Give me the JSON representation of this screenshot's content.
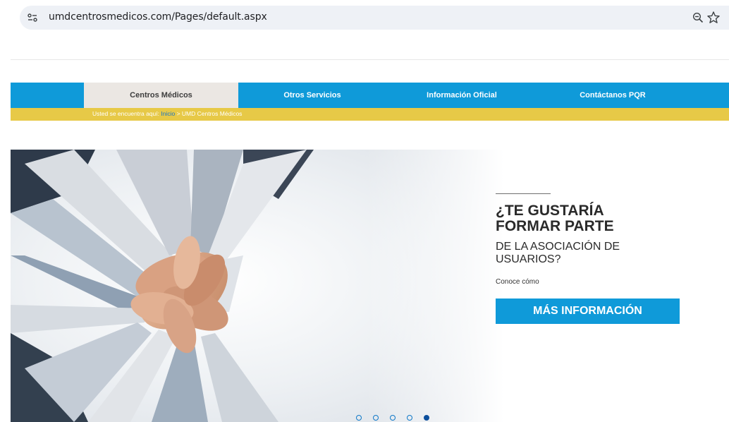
{
  "browser": {
    "url": "umdcentrosmedicos.com/Pages/default.aspx",
    "icons": [
      "site-info-icon",
      "zoom-icon",
      "bookmark-star-icon"
    ]
  },
  "nav": {
    "items": [
      {
        "label": "Centros Médicos",
        "active": true
      },
      {
        "label": "Otros Servicios",
        "active": false
      },
      {
        "label": "Información Oficial",
        "active": false
      },
      {
        "label": "Contáctanos PQR",
        "active": false
      }
    ],
    "color": "#0f9ad9",
    "active_color": "#ebe7e3"
  },
  "breadcrumb": {
    "prefix": "Usted se encuentra aquí:",
    "home": "Inicio",
    "separator": ">",
    "current": "UMD Centros Médicos",
    "bar_color": "#e7c947"
  },
  "hero": {
    "heading_line1": "¿TE GUSTARÍA",
    "heading_line2": "FORMAR PARTE",
    "sub_line1": "DE LA ASOCIACIÓN DE",
    "sub_line2": "USUARIOS?",
    "small_text": "Conoce cómo",
    "button_label": "MÁS INFORMACIÓN",
    "button_color": "#0f9ad9"
  },
  "carousel": {
    "total": 5,
    "active_index": 4
  }
}
